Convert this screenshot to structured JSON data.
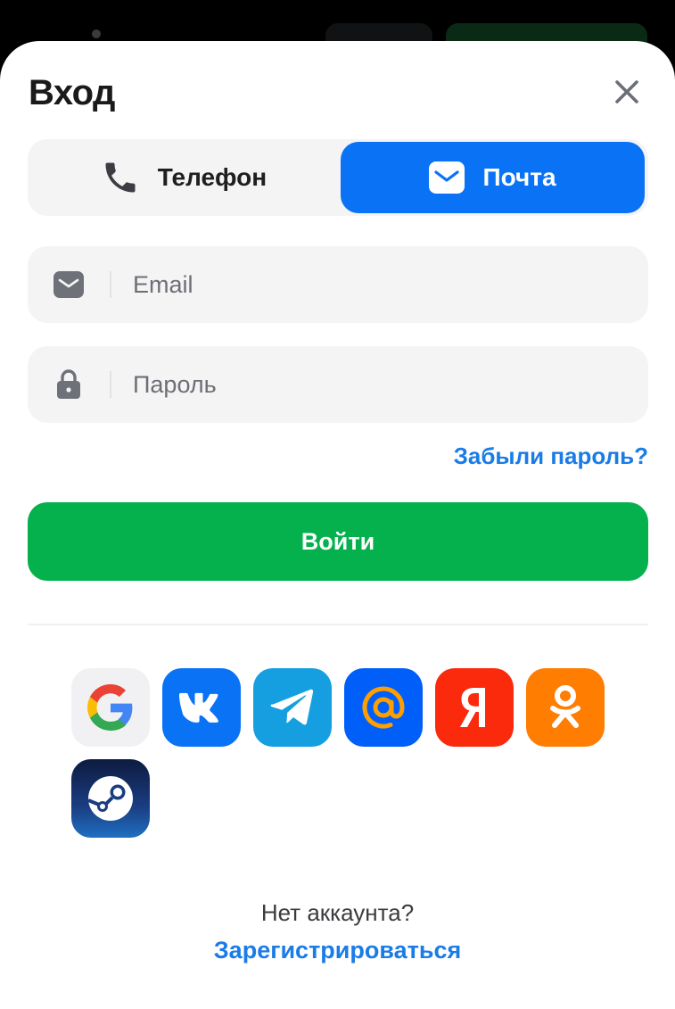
{
  "header": {
    "title": "Вход"
  },
  "tabs": [
    {
      "id": "phone",
      "label": "Телефон",
      "icon": "phone-icon",
      "active": false
    },
    {
      "id": "mail",
      "label": "Почта",
      "icon": "mail-icon",
      "active": true
    }
  ],
  "form": {
    "email": {
      "placeholder": "Email",
      "value": "",
      "icon": "mail-icon"
    },
    "password": {
      "placeholder": "Пароль",
      "value": "",
      "icon": "lock-icon"
    },
    "forgot_label": "Забыли пароль?",
    "submit_label": "Войти"
  },
  "social": [
    {
      "name": "google",
      "icon": "google-icon",
      "bg": "#f1f1f3"
    },
    {
      "name": "vk",
      "icon": "vk-icon",
      "bg": "#0a72f5"
    },
    {
      "name": "telegram",
      "icon": "telegram-icon",
      "bg": "#169fe0"
    },
    {
      "name": "mail-ru",
      "icon": "at-icon",
      "bg": "#005ff9"
    },
    {
      "name": "yandex",
      "icon": "yandex-icon",
      "bg": "#fc2a0c"
    },
    {
      "name": "odnoklassniki",
      "icon": "ok-icon",
      "bg": "#ff7d00"
    },
    {
      "name": "steam",
      "icon": "steam-icon",
      "bg": "#0e2a5b"
    }
  ],
  "footer": {
    "no_account_text": "Нет аккаунта?",
    "register_label": "Зарегистрироваться"
  },
  "colors": {
    "accent_blue": "#0a72f5",
    "link_blue": "#1a7ce6",
    "primary_green": "#05b14d",
    "field_bg": "#f4f4f5"
  }
}
